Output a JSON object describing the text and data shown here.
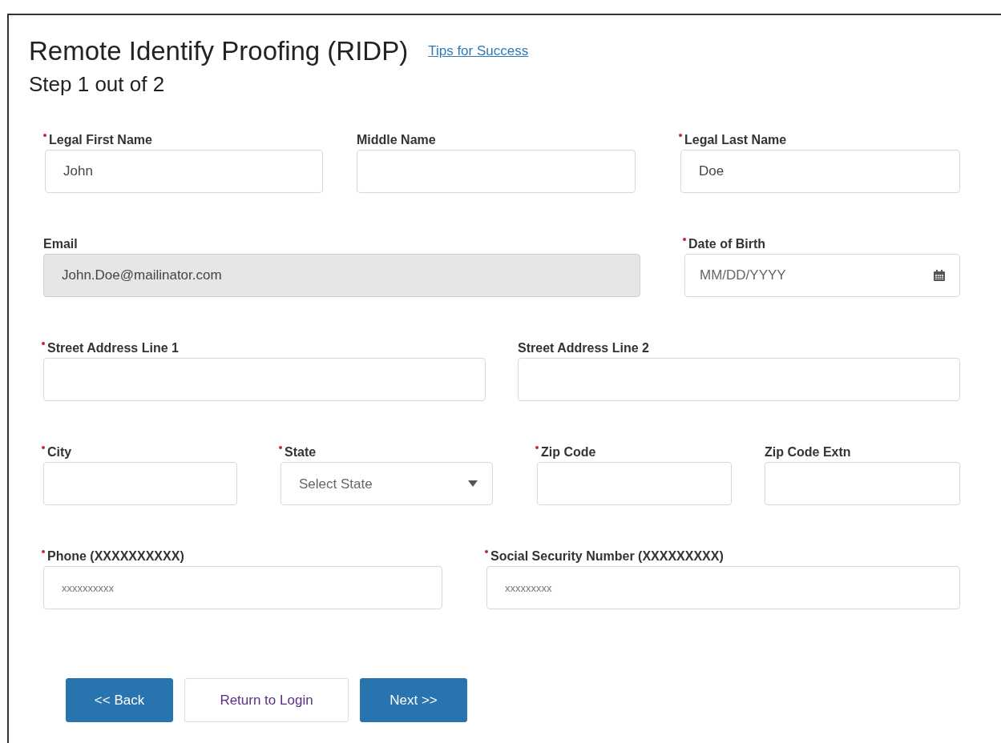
{
  "title": "Remote Identify Proofing (RIDP)",
  "tips_link": "Tips for Success",
  "step": "Step 1 out of 2",
  "rows": [
    {
      "fields": [
        {
          "label": "Legal First Name",
          "required": true,
          "kind": "text",
          "value": "John",
          "disabled": false
        },
        {
          "label": "Middle Name",
          "required": false,
          "kind": "text",
          "disabled": false
        },
        {
          "label": "Legal Last Name",
          "required": true,
          "kind": "text",
          "value": "Doe",
          "disabled": false
        }
      ]
    },
    {
      "fields": [
        {
          "label": "Email",
          "required": false,
          "kind": "text",
          "value": "John.Doe@mailinator.com",
          "disabled": true
        },
        {
          "label": "Date of Birth",
          "required": true,
          "kind": "date",
          "placeholder": "MM/DD/YYYY",
          "disabled": false
        }
      ]
    },
    {
      "fields": [
        {
          "label": "Street Address Line 1",
          "required": true,
          "kind": "text",
          "disabled": false
        },
        {
          "label": "Street Address Line 2",
          "required": false,
          "kind": "text",
          "disabled": false
        }
      ]
    },
    {
      "fields": [
        {
          "label": "City",
          "required": true,
          "kind": "text",
          "disabled": false
        },
        {
          "label": "State",
          "required": true,
          "kind": "select",
          "placeholder": "Select State",
          "disabled": false
        },
        {
          "label": "Zip Code",
          "required": true,
          "kind": "text",
          "disabled": false
        },
        {
          "label": "Zip Code Extn",
          "required": false,
          "kind": "text",
          "disabled": false
        }
      ]
    },
    {
      "fields": [
        {
          "label": "Phone (XXXXXXXXXX)",
          "required": true,
          "kind": "text",
          "placeholder": "xxxxxxxxxx",
          "disabled": false
        },
        {
          "label": "Social Security Number (XXXXXXXXX)",
          "required": true,
          "kind": "text",
          "placeholder": "xxxxxxxxx",
          "disabled": false
        }
      ]
    }
  ],
  "buttons": [
    {
      "label": "<< Back",
      "kind": "primary"
    },
    {
      "label": "Return to Login",
      "kind": "secondary"
    },
    {
      "label": "Next >>",
      "kind": "primary"
    }
  ]
}
